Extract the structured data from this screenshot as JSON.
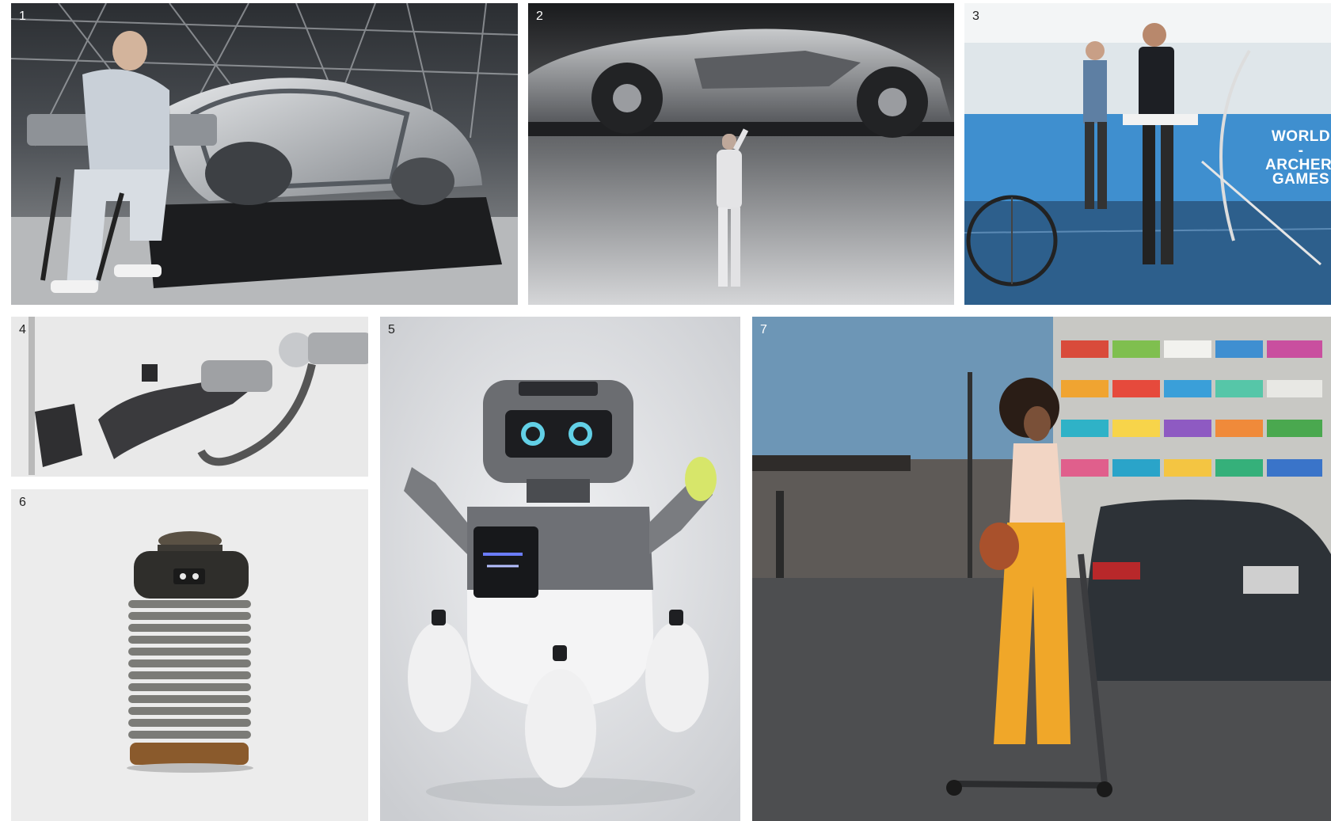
{
  "panels": [
    {
      "number": "1"
    },
    {
      "number": "2"
    },
    {
      "number": "3",
      "signage": {
        "line1": "WORLD",
        "line2": "-ARCHERY-",
        "line3": "GAMES"
      }
    },
    {
      "number": "4"
    },
    {
      "number": "5"
    },
    {
      "number": "6"
    },
    {
      "number": "7"
    }
  ]
}
